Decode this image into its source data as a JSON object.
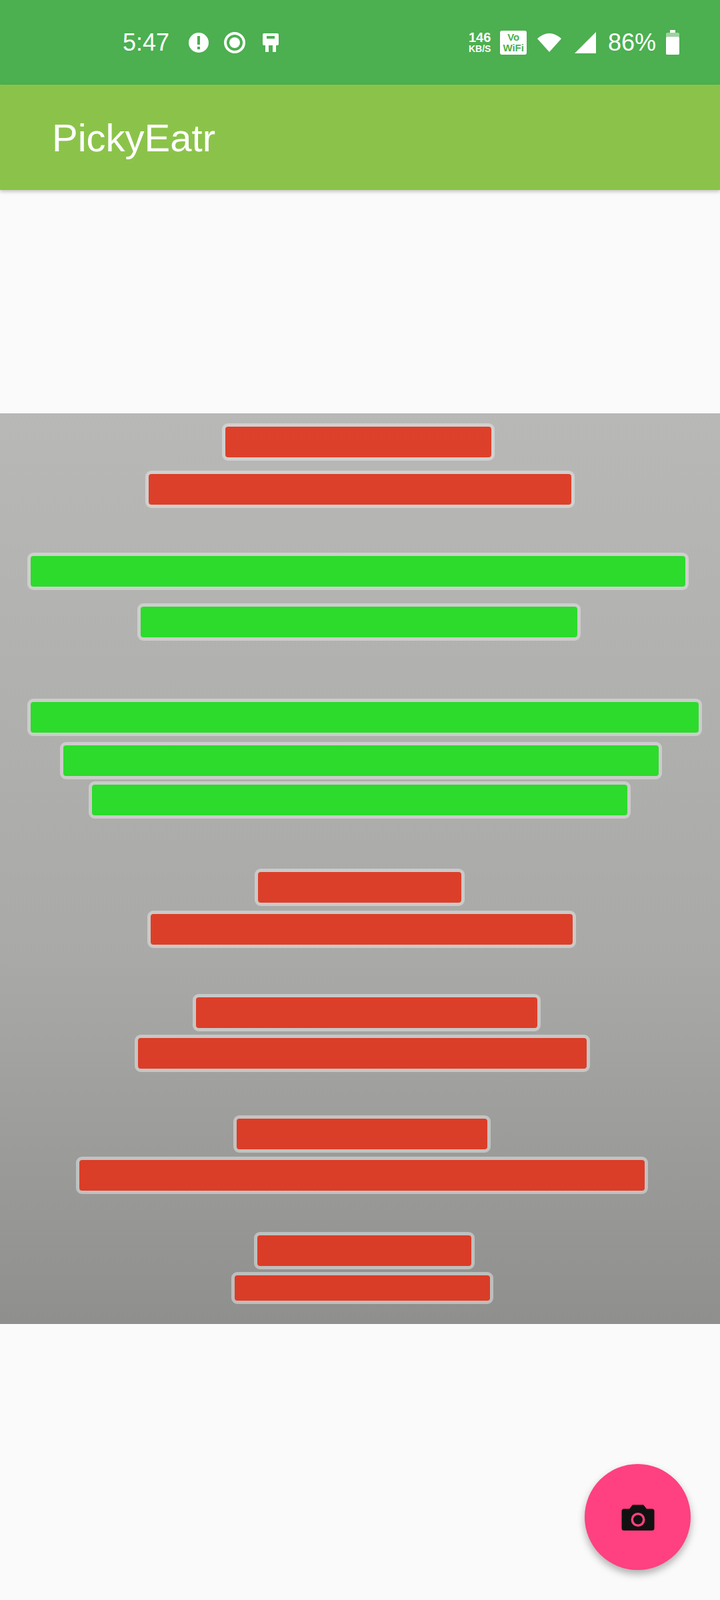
{
  "status_bar": {
    "time": "5:47",
    "speed": {
      "value": "146",
      "unit": "KB/S"
    },
    "vowifi": {
      "top": "Vo",
      "bottom": "WiFi"
    },
    "battery": {
      "reading": "86%",
      "level": 0.86
    }
  },
  "app_bar": {
    "title": "PickyEatr"
  },
  "photo": {
    "highlights": [
      {
        "color": "#e2341c"
      },
      {
        "color": "#e2341c"
      },
      {
        "color": "#1fe01f"
      },
      {
        "color": "#1fe01f"
      },
      {
        "color": "#1fe01f"
      },
      {
        "color": "#1fe01f"
      },
      {
        "color": "#1fe01f"
      },
      {
        "color": "#e2341c"
      },
      {
        "color": "#e2341c"
      },
      {
        "color": "#e2341c"
      },
      {
        "color": "#e2341c"
      },
      {
        "color": "#e2341c"
      },
      {
        "color": "#e2341c"
      },
      {
        "color": "#e2341c"
      },
      {
        "color": "#e2341c"
      }
    ]
  }
}
